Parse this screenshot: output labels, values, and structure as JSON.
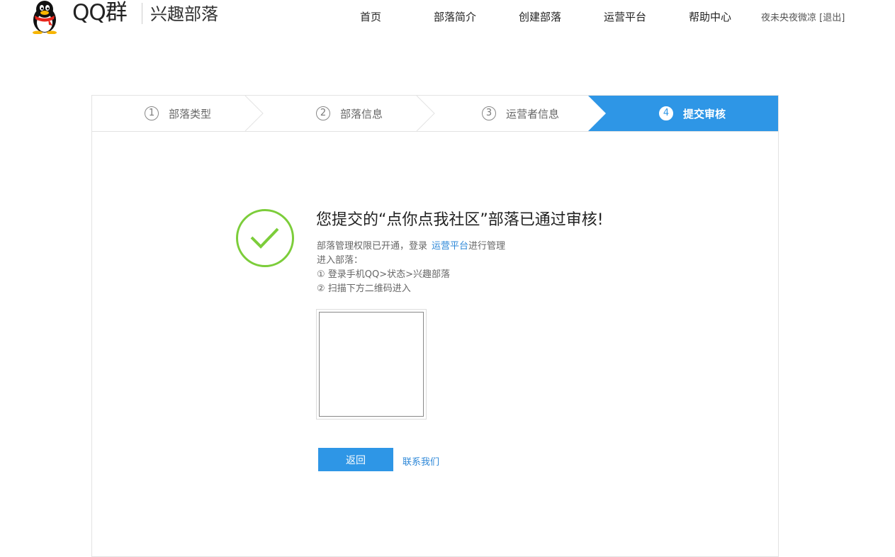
{
  "header": {
    "logo_title": "QQ群",
    "logo_subtitle": "兴趣部落",
    "nav": [
      {
        "label": "首页"
      },
      {
        "label": "部落简介"
      },
      {
        "label": "创建部落"
      },
      {
        "label": "运营平台"
      },
      {
        "label": "帮助中心"
      }
    ],
    "user_name": "夜未央夜微凉",
    "logout_label": "[退出]"
  },
  "steps": [
    {
      "num": "1",
      "label": "部落类型",
      "active": false
    },
    {
      "num": "2",
      "label": "部落信息",
      "active": false
    },
    {
      "num": "3",
      "label": "运营者信息",
      "active": false
    },
    {
      "num": "4",
      "label": "提交审核",
      "active": true
    }
  ],
  "result": {
    "title": "您提交的“点你点我社区”部落已通过审核!",
    "line1_prefix": "部落管理权限已开通，登录",
    "line1_link": "运营平台",
    "line1_suffix": "进行管理",
    "line2": "进入部落：",
    "line3": "① 登录手机QQ>状态>兴趣部落",
    "line4": "② 扫描下方二维码进入",
    "back_button": "返回",
    "contact_link": "联系我们"
  },
  "colors": {
    "accent": "#2e96e6",
    "success": "#7ccd3a",
    "link": "#2e88d8"
  }
}
